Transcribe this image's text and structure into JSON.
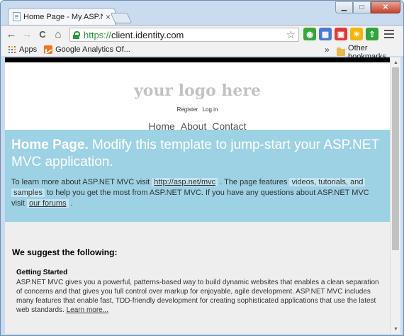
{
  "browser": {
    "tab_title": "Home Page - My ASP.NET",
    "tab_close": "×",
    "url_scheme": "https://",
    "url_host": "client.identity.com",
    "window_buttons": {
      "minimize": "▁",
      "maximize": "□",
      "close": "✕"
    },
    "nav": {
      "back": "←",
      "forward": "→",
      "reload": "C",
      "home": "⌂"
    },
    "star": "☆",
    "extensions": [
      {
        "name": "evernote-like",
        "color": "#3aa53a",
        "glyph": "◉"
      },
      {
        "name": "calendar",
        "color": "#4b7bd1",
        "glyph": "▦"
      },
      {
        "name": "notes",
        "color": "#d93a3a",
        "glyph": "▣"
      },
      {
        "name": "weather",
        "color": "#f2b40e",
        "glyph": "☀"
      },
      {
        "name": "upload",
        "color": "#2fa43a",
        "glyph": "⇧"
      }
    ],
    "bookmarks": {
      "apps_label": "Apps",
      "analytics_label": "Google Analytics Of...",
      "more": "»",
      "other_label": "Other bookmarks"
    }
  },
  "page": {
    "logo": "your logo here",
    "register_link": "Register",
    "login_link": "Log in",
    "nav": [
      "Home",
      "About",
      "Contact"
    ],
    "featured": {
      "title_bold": "Home Page.",
      "title_rest": " Modify this template to jump-start your ASP.NET MVC application.",
      "text_1": "To learn more about ASP.NET MVC visit ",
      "link_asp": "http://asp.net/mvc",
      "text_2": " . The page features ",
      "highlight_1": "videos, tutorials, and",
      "highlight_2": "samples",
      "text_3": " to help you get the most from ASP.NET MVC. If you have any questions about ASP.NET MVC visit ",
      "link_forums": "our forums",
      "text_4": " ."
    },
    "suggest_heading": "We suggest the following:",
    "getting_started": {
      "heading": "Getting Started",
      "text": "ASP.NET MVC gives you a powerful, patterns-based way to build dynamic websites that enables a clean separation of concerns and that gives you full control over markup for enjoyable, agile development. ASP.NET MVC includes many features that enable fast, TDD-friendly development for creating sophisticated applications that use the latest web standards. ",
      "learn_more": "Learn more..."
    }
  },
  "scrollbar": {
    "up": "▲",
    "down": "▼"
  }
}
